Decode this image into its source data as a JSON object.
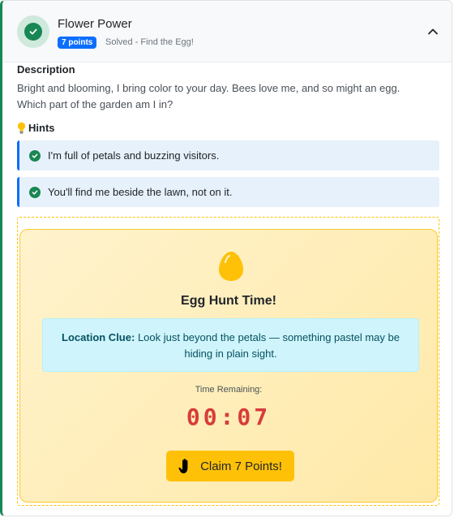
{
  "challenge": {
    "title": "Flower Power",
    "points_badge": "7 points",
    "status": "Solved - Find the Egg!"
  },
  "description": {
    "label": "Description",
    "text": "Bright and blooming, I bring color to your day. Bees love me, and so might an egg. Which part of the garden am I in?"
  },
  "hints": {
    "label": "Hints",
    "items": [
      {
        "text": "I'm full of petals and buzzing visitors."
      },
      {
        "text": "You'll find me beside the lawn, not on it."
      }
    ]
  },
  "egg_hunt": {
    "title": "Egg Hunt Time!",
    "clue_label": "Location Clue:",
    "clue_text": "Look just beyond the petals — something pastel may be hiding in plain sight.",
    "time_label": "Time Remaining:",
    "timer": "00:07",
    "claim_label": "Claim 7 Points!"
  },
  "icons": {
    "status": "check-circle-icon",
    "collapse": "chevron-up-icon",
    "hints": "lightbulb-icon",
    "hint_item": "check-circle-icon",
    "egg": "egg-icon",
    "claim": "hand-icon"
  },
  "colors": {
    "success": "#198754",
    "primary": "#0d6efd",
    "warning": "#ffc107",
    "timer": "#d63c3c",
    "clue_bg": "#cff4fc"
  }
}
